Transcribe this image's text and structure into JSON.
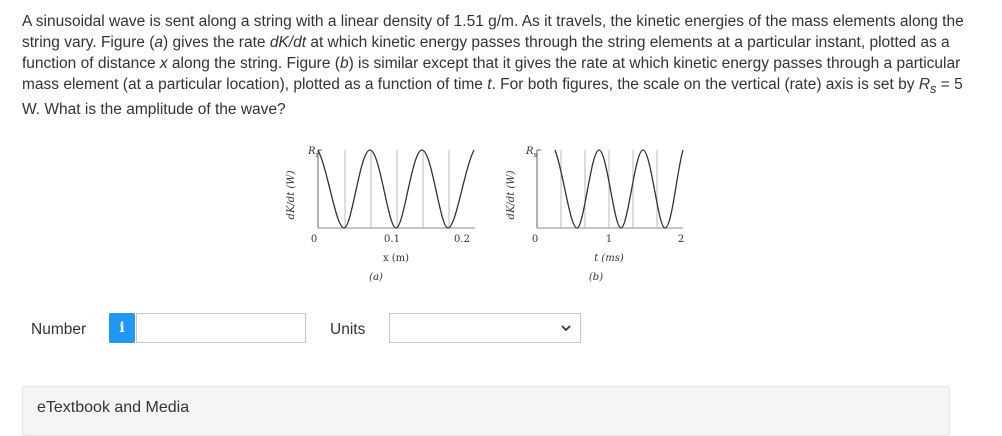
{
  "question": {
    "part1": "A sinusoidal wave is sent along a string with a linear density of 1.51 g/m. As it travels, the kinetic energies of the mass elements along the string vary. Figure (",
    "a1": "a",
    "part2": ") gives the rate ",
    "dkdt1": "dK/dt",
    "part3": " at which kinetic energy passes through the string elements at a particular instant, plotted as a function of distance ",
    "xvar": "x",
    "part4": " along the string. Figure (",
    "b1": "b",
    "part5": ") is similar except that it gives the rate at which kinetic energy passes through a particular mass element (at a particular location), plotted as a function of time ",
    "tvar": "t",
    "part6": ". For both figures, the scale on the vertical (rate) axis is set by ",
    "rs_base": "R",
    "rs_sub": "s",
    "part7": " = 5 W. What is the amplitude of the wave?"
  },
  "figure_a": {
    "ylabel": "dK/dt (W)",
    "rs_label": "R",
    "rs_sub": "s",
    "ticks": [
      "0",
      "0.1",
      "0.2"
    ],
    "xlabel": "x (m)",
    "caption": "(a)"
  },
  "figure_b": {
    "ylabel": "dK/dt (W)",
    "rs_label": "R",
    "rs_sub": "s",
    "ticks": [
      "0",
      "1",
      "2"
    ],
    "xlabel": "t (ms)",
    "caption": "(b)"
  },
  "answer": {
    "number_label": "Number",
    "info_icon": "i",
    "number_value": "",
    "units_label": "Units",
    "units_value": ""
  },
  "etextbook": {
    "label": "eTextbook and Media"
  }
}
